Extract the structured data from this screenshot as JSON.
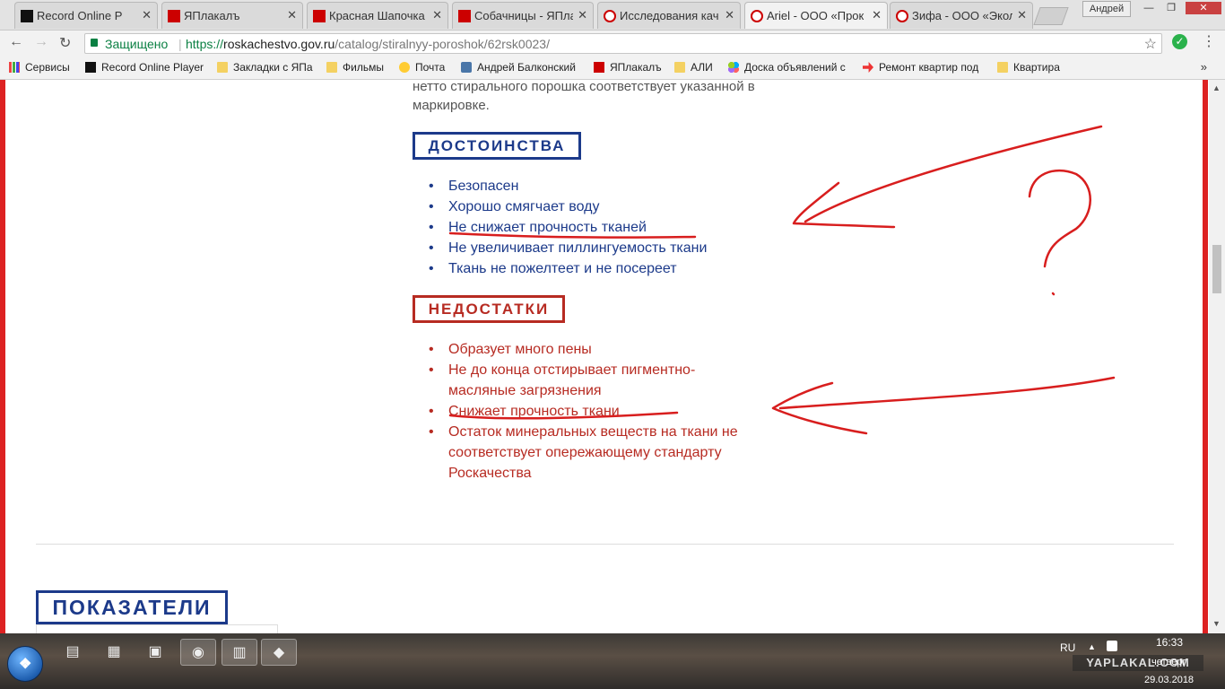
{
  "tabs": [
    {
      "title": "Record Online P",
      "favicon": "record-player-icon",
      "active": false
    },
    {
      "title": "ЯПлакалъ",
      "favicon": "yaplakal-icon",
      "active": false
    },
    {
      "title": "Красная Шапочка",
      "favicon": "yaplakal-icon",
      "active": false
    },
    {
      "title": "Собачницы - ЯПла",
      "favicon": "yaplakal-icon",
      "active": false
    },
    {
      "title": "Исследования кач",
      "favicon": "roskachestvo-icon",
      "active": false
    },
    {
      "title": "Ariel - ООО «Прок",
      "favicon": "roskachestvo-icon",
      "active": true
    },
    {
      "title": "Зифа - ООО «Экол",
      "favicon": "roskachestvo-icon",
      "active": false
    }
  ],
  "window": {
    "user": "Андрей",
    "minimize": "—",
    "restore": "❐",
    "close": "✕"
  },
  "nav": {
    "back": "←",
    "forward": "→",
    "reload": "↻"
  },
  "address_bar": {
    "secure_label": "Защищено",
    "url_protocol": "https://",
    "url_host": "roskachestvo.gov.ru",
    "url_path": "/catalog/stiralnyy-poroshok/62rsk0023/"
  },
  "bookmarks": [
    {
      "label": "Сервисы",
      "icon": "apps-grid-icon"
    },
    {
      "label": "Record Online Player",
      "icon": "record-player-icon"
    },
    {
      "label": "Закладки с ЯПа",
      "icon": "folder-icon"
    },
    {
      "label": "Фильмы",
      "icon": "folder-icon"
    },
    {
      "label": "Почта",
      "icon": "mail-icon"
    },
    {
      "label": "Андрей Балконский",
      "icon": "vk-icon"
    },
    {
      "label": "ЯПлакалъ",
      "icon": "yaplakal-icon"
    },
    {
      "label": "АЛИ",
      "icon": "folder-icon"
    },
    {
      "label": "Доска объявлений с",
      "icon": "avito-icon"
    },
    {
      "label": "Ремонт квартир под",
      "icon": "arrow-icon"
    },
    {
      "label": "Квартира",
      "icon": "folder-icon"
    }
  ],
  "bookmarks_more": "»",
  "page": {
    "intro_line1": "нетто стирального порошка соответствует указанной в",
    "intro_line2": "маркировке.",
    "pros_title": "ДОСТОИНСТВА",
    "pros": [
      "Безопасен",
      "Хорошо смягчает воду",
      "Не снижает прочность тканей",
      "Не увеличивает пиллингуемость ткани",
      "Ткань не пожелтеет и не посереет"
    ],
    "cons_title": "НЕДОСТАТКИ",
    "cons": [
      "Образует много пены",
      "Не до конца отстирывает пигментно-масляные загрязнения",
      "Снижает прочность ткани",
      "Остаток минеральных веществ на ткани не соответствует опережающему стандарту Роскачества"
    ],
    "indicators_title": "ПОКАЗАТЕЛИ"
  },
  "colors": {
    "pros_blue": "#1c3a8a",
    "cons_red": "#b72b22",
    "annotation_red": "#d81e1e",
    "secure_green": "#0b8043"
  },
  "taskbar": {
    "language": "RU",
    "time": "16:33",
    "day": "четверг",
    "date": "29.03.2018",
    "watermark": "YAPLAKAL.COM"
  }
}
